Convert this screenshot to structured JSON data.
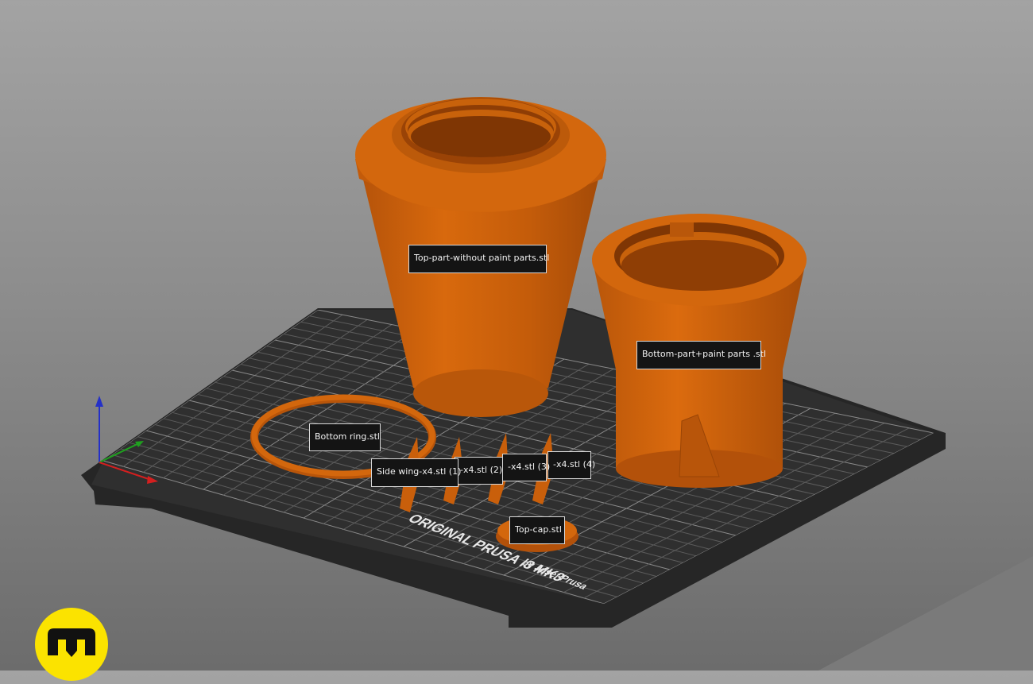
{
  "scene": {
    "bed_text_line1": "ORIGINAL PRUSA i3 MK3",
    "bed_text_line2": "by Josef Prusa",
    "colors": {
      "filament": "#c85f0a",
      "bed": "#2d2d2d",
      "grid": "#5a5a5a",
      "axis_x": "#d41f1f",
      "axis_y": "#1fa01f",
      "axis_z": "#2430c8",
      "logo": "#fbe300"
    }
  },
  "objects": [
    {
      "name": "Top-part-without paint parts.stl"
    },
    {
      "name": "Bottom-part+paint parts .stl"
    },
    {
      "name": "Bottom ring.stl"
    },
    {
      "name": "Side wing-x4.stl (1)"
    },
    {
      "name": "-x4.stl (2)"
    },
    {
      "name": "-x4.stl (3)"
    },
    {
      "name": "-x4.stl (4)"
    },
    {
      "name": "Top-cap.stl"
    }
  ],
  "watermark": {
    "icon": "manufacturer-logo-icon"
  }
}
